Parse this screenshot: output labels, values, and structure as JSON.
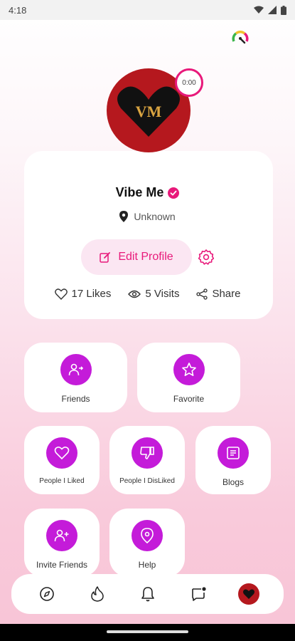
{
  "status_bar": {
    "time": "4:18"
  },
  "timer": {
    "value": "0:00"
  },
  "profile": {
    "avatar_initials": "VM",
    "name": "Vibe Me",
    "location": "Unknown",
    "edit_label": "Edit Profile",
    "likes": "17 Likes",
    "visits": "5 Visits",
    "share": "Share"
  },
  "tiles": {
    "friends": "Friends",
    "favorite": "Favorite",
    "people_liked": "People I Liked",
    "people_disliked": "People I DisLiked",
    "blogs": "Blogs",
    "invite_friends": "Invite Friends",
    "help": "Help"
  },
  "colors": {
    "accent": "#e8197a",
    "tile_icon": "#c41bd9",
    "avatar_bg": "#b5181e"
  }
}
